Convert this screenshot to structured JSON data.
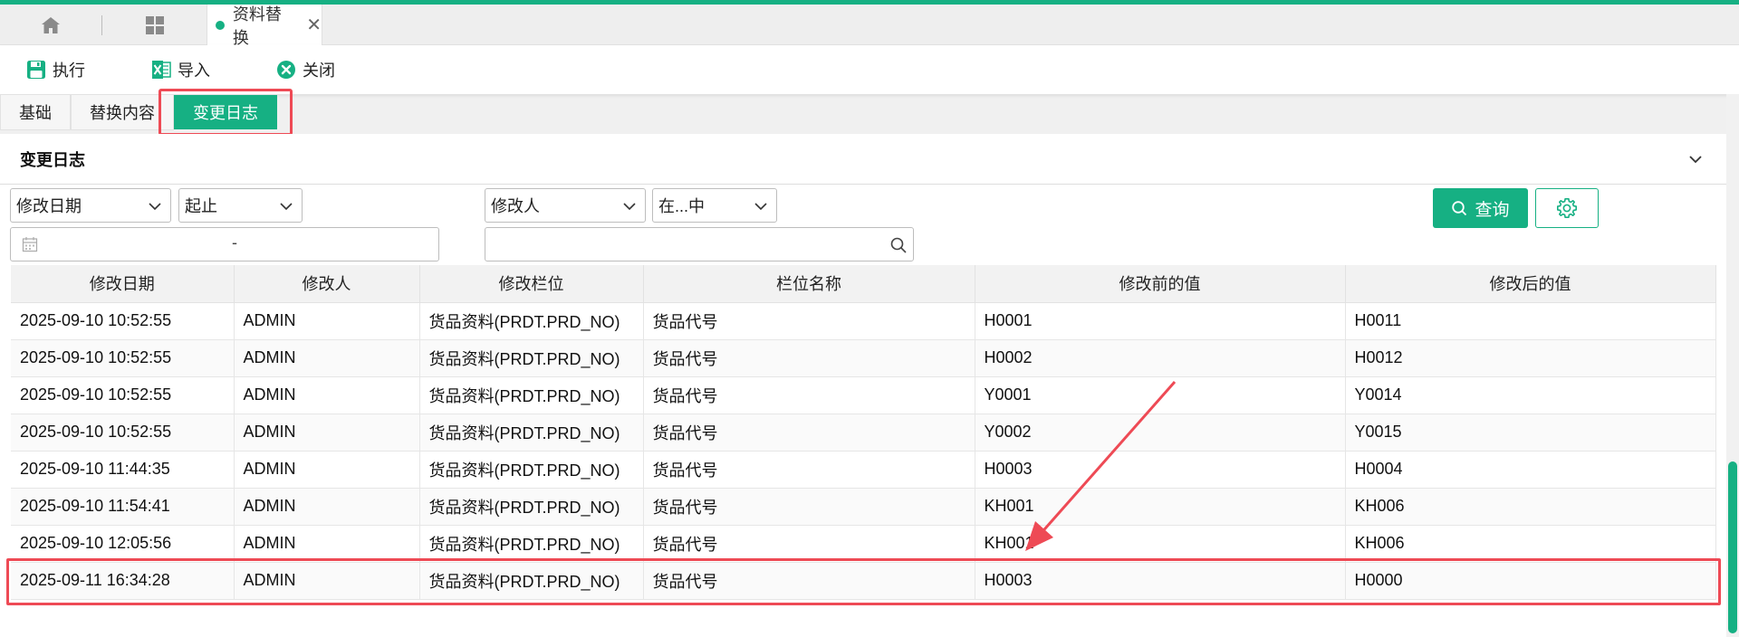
{
  "colors": {
    "accent": "#16b083",
    "annotation": "#ee4a55"
  },
  "tabbar": {
    "home_icon": "home-icon",
    "apps_icon": "apps-grid-icon",
    "doc_tab_label": "资料替换",
    "close_glyph": "✕"
  },
  "toolbar": {
    "execute_label": "执行",
    "import_label": "导入",
    "close_label": "关闭"
  },
  "subtabs": {
    "basic": "基础",
    "replace": "替换内容",
    "log": "变更日志",
    "active": "变更日志"
  },
  "panel": {
    "title": "变更日志",
    "filters": {
      "date_field": "修改日期",
      "date_range": "起止",
      "date_separator": "-",
      "user_field": "修改人",
      "user_op": "在...中",
      "user_value": "",
      "query_label": "查询"
    }
  },
  "table": {
    "columns": [
      "修改日期",
      "修改人",
      "修改栏位",
      "栏位名称",
      "修改前的值",
      "修改后的值"
    ],
    "rows": [
      [
        "2025-09-10 10:52:55",
        "ADMIN",
        "货品资料(PRDT.PRD_NO)",
        "货品代号",
        "H0001",
        "H0011"
      ],
      [
        "2025-09-10 10:52:55",
        "ADMIN",
        "货品资料(PRDT.PRD_NO)",
        "货品代号",
        "H0002",
        "H0012"
      ],
      [
        "2025-09-10 10:52:55",
        "ADMIN",
        "货品资料(PRDT.PRD_NO)",
        "货品代号",
        "Y0001",
        "Y0014"
      ],
      [
        "2025-09-10 10:52:55",
        "ADMIN",
        "货品资料(PRDT.PRD_NO)",
        "货品代号",
        "Y0002",
        "Y0015"
      ],
      [
        "2025-09-10 11:44:35",
        "ADMIN",
        "货品资料(PRDT.PRD_NO)",
        "货品代号",
        "H0003",
        "H0004"
      ],
      [
        "2025-09-10 11:54:41",
        "ADMIN",
        "货品资料(PRDT.PRD_NO)",
        "货品代号",
        "KH001",
        "KH006"
      ],
      [
        "2025-09-10 12:05:56",
        "ADMIN",
        "货品资料(PRDT.PRD_NO)",
        "货品代号",
        "KH001",
        "KH006"
      ],
      [
        "2025-09-11 16:34:28",
        "ADMIN",
        "货品资料(PRDT.PRD_NO)",
        "货品代号",
        "H0003",
        "H0000"
      ]
    ],
    "highlighted_row": 8
  }
}
